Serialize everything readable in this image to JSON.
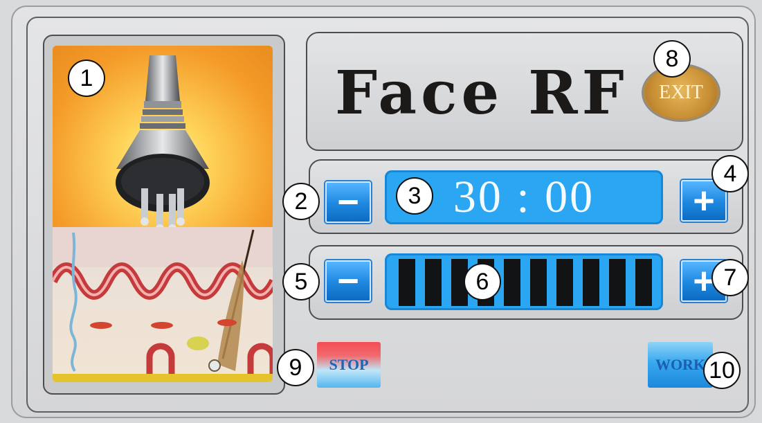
{
  "title": "Face RF",
  "exit_label": "EXIT",
  "timer": {
    "value": "30 : 00",
    "minus_label": "−",
    "plus_label": "+"
  },
  "intensity": {
    "minus_label": "−",
    "plus_label": "+",
    "level": 10,
    "max_level": 10
  },
  "buttons": {
    "stop_label": "STOP",
    "work_label": "WORK"
  },
  "callouts": [
    "1",
    "2",
    "3",
    "4",
    "5",
    "6",
    "7",
    "8",
    "9",
    "10"
  ],
  "colors": {
    "accent_blue": "#2aa6f2",
    "button_blue": "#1d87df",
    "exit_gold": "#c78d33",
    "stop_red": "#f34d55"
  }
}
